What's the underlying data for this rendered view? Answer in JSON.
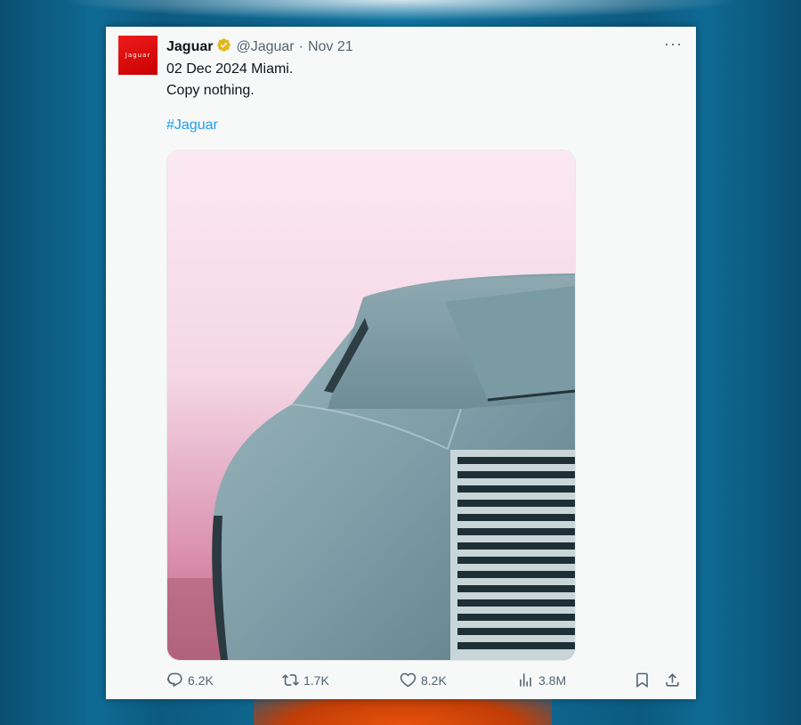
{
  "tweet": {
    "avatar_text": "Jaguar",
    "display_name": "Jaguar",
    "handle": "@Jaguar",
    "separator": "·",
    "date": "Nov 21",
    "line1": "02 Dec 2024 Miami.",
    "line2": "Copy nothing.",
    "hashtag": "#Jaguar",
    "more_label": "···"
  },
  "stats": {
    "replies": "6.2K",
    "reposts": "1.7K",
    "likes": "8.2K",
    "views": "3.8M"
  },
  "icons": {
    "verified": "verified-badge-icon",
    "reply": "reply-icon",
    "repost": "repost-icon",
    "like": "heart-icon",
    "views": "views-bar-chart-icon",
    "bookmark": "bookmark-icon",
    "share": "share-icon"
  },
  "colors": {
    "verified_gold": "#e2b719",
    "link_blue": "#1d9bf0",
    "avatar_red": "#e41414"
  }
}
